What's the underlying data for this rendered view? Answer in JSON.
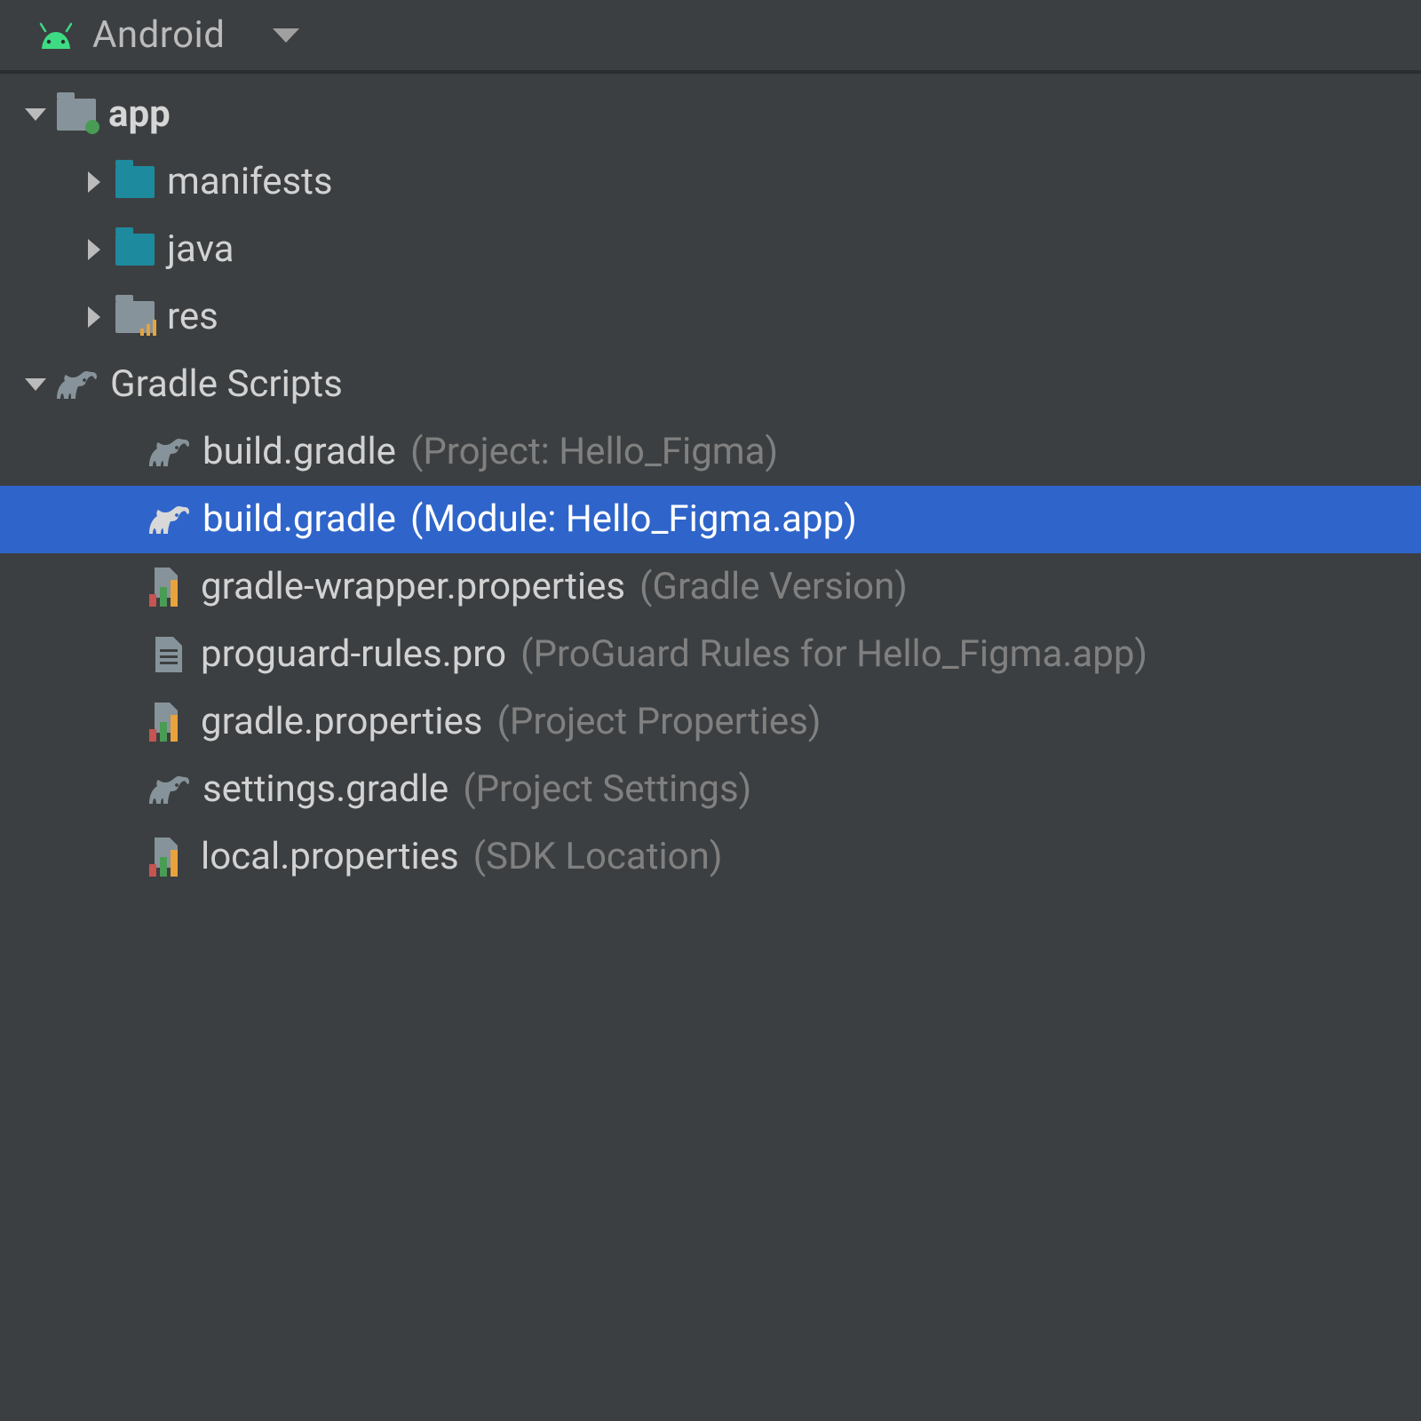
{
  "toolbar": {
    "view_label": "Android"
  },
  "tree": {
    "app": {
      "label": "app",
      "children": {
        "manifests": "manifests",
        "java": "java",
        "res": "res"
      }
    },
    "gradle_scripts": {
      "label": "Gradle Scripts",
      "items": [
        {
          "name": "build.gradle",
          "hint": "(Project: Hello_Figma)",
          "icon": "elephant",
          "selected": false
        },
        {
          "name": "build.gradle",
          "hint": "(Module: Hello_Figma.app)",
          "icon": "elephant",
          "selected": true
        },
        {
          "name": "gradle-wrapper.properties",
          "hint": "(Gradle Version)",
          "icon": "props",
          "selected": false
        },
        {
          "name": "proguard-rules.pro",
          "hint": "(ProGuard Rules for Hello_Figma.app)",
          "icon": "txtfile",
          "selected": false
        },
        {
          "name": "gradle.properties",
          "hint": "(Project Properties)",
          "icon": "props",
          "selected": false
        },
        {
          "name": "settings.gradle",
          "hint": "(Project Settings)",
          "icon": "elephant",
          "selected": false
        },
        {
          "name": "local.properties",
          "hint": "(SDK Location)",
          "icon": "props",
          "selected": false
        }
      ]
    }
  }
}
